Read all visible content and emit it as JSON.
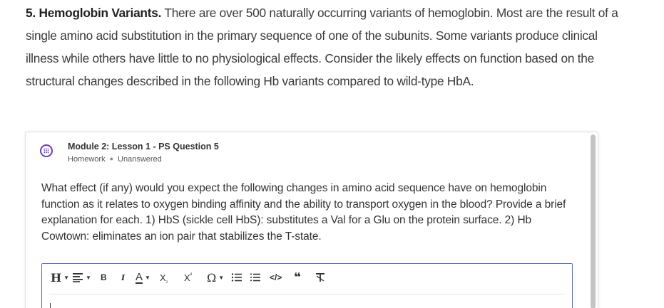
{
  "intro": {
    "lead": "5. Hemoglobin Variants.",
    "text": " There are over 500 naturally occurring variants of hemoglobin. Most are the result of a single amino acid substitution in the primary sequence of one of the subunits. Some variants produce clinical illness while others have little to no physiological effects. Consider the likely effects on function based on the structural changes described in the following Hb variants compared to wild-type HbA."
  },
  "question": {
    "icon": "chat-bubble-icon",
    "title": "Module 2: Lesson 1 - PS Question 5",
    "type": "Homework",
    "status": "Unanswered",
    "body": "What effect (if any) would you expect the following changes in amino acid sequence have on hemoglobin function as it relates to oxygen binding affinity and the ability to transport oxygen in the blood? Provide a brief explanation for each. 1) HbS (sickle cell HbS): substitutes a Val for a Glu on the protein surface. 2) Hb Cowtown: eliminates an ion pair that stabilizes the T-state."
  },
  "toolbar": {
    "heading": "H",
    "bold": "B",
    "italic": "I",
    "font_color": "A",
    "subscript": "X",
    "subscript_mark": "₂",
    "superscript": "X",
    "superscript_mark": "²",
    "special_char": "Ω",
    "quote": "❝",
    "code": "</>"
  },
  "editor": {
    "value": ""
  },
  "colors": {
    "accent": "#6a3fb5",
    "editor_border": "#5a6fb0",
    "text": "#333333"
  }
}
